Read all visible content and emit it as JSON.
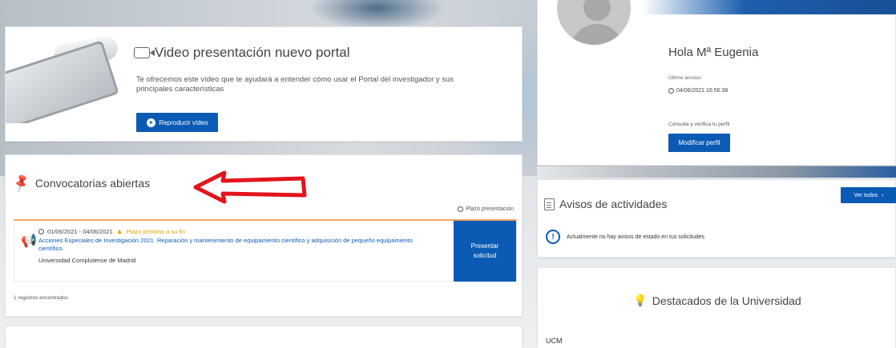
{
  "video": {
    "title": "Video presentación nuevo portal",
    "description": "Te ofrecemos este vídeo que te ayudará a entender cómo usar el Portal del investigador y sus principales características",
    "play_label": "Reproducir vídeo"
  },
  "convocatorias": {
    "title": "Convocatorias abiertas",
    "plazo_label": "Plazo presentación",
    "item": {
      "dates": "01/06/2021 - 04/06/2021",
      "warning": "Plazo próximo a su fin",
      "link": "Acciones Especiales de Investigación 2021. Reparación y mantenimiento de equipamiento científico y adquisición de pequeño equipamiento científico.",
      "org": "Universidad Complutense de Madrid",
      "action_line1": "Presentar",
      "action_line2": "solicitud"
    },
    "records": "1 registros encontrados"
  },
  "profile": {
    "greeting": "Hola Mª Eugenia",
    "last_access_label": "Último acceso",
    "last_access_value": "04/06/2021 16:56:38",
    "hint": "Consulta y verifica tu perfil",
    "modify_label": "Modificar perfil"
  },
  "avisos": {
    "title": "Avisos de actividades",
    "view_all": "Ver todos",
    "message": "Actualmente no hay avisos de estado en tus solicitudes"
  },
  "destacados": {
    "title": "Destacados de la Universidad",
    "first_item": "UCM"
  },
  "colors": {
    "primary": "#0b5bb5",
    "warning": "#e0a100",
    "arrow": "#e3141b",
    "accent_border": "#f4a261"
  }
}
